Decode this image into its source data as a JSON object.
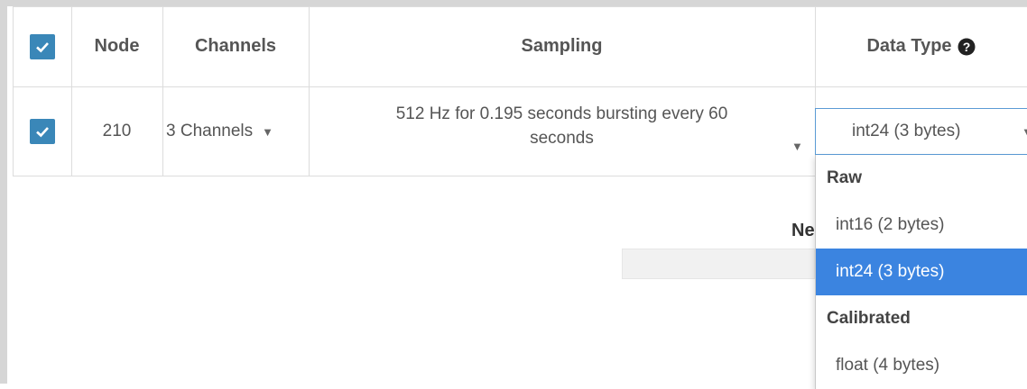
{
  "table": {
    "headers": {
      "node": "Node",
      "channels": "Channels",
      "sampling": "Sampling",
      "data_type": "Data Type"
    },
    "row": {
      "checked": true,
      "node": "210",
      "channels": "3 Channels",
      "sampling_line1": "512 Hz for 0.195 seconds bursting every 60",
      "sampling_line2": "seconds",
      "data_type": "int24 (3 bytes)"
    }
  },
  "background_partial_text": "Ne",
  "dropdown": {
    "groups": [
      {
        "label": "Raw",
        "options": [
          "int16 (2 bytes)",
          "int24 (3 bytes)"
        ]
      },
      {
        "label": "Calibrated",
        "options": [
          "float (4 bytes)"
        ]
      }
    ],
    "selected": "int24 (3 bytes)"
  },
  "icons": {
    "checkbox": "check-icon",
    "caret": "caret-down-icon",
    "help": "question-circle-icon"
  },
  "colors": {
    "checkbox": "#3a87b8",
    "selected_option": "#3b84e0",
    "select_border": "#5b9bd5"
  }
}
